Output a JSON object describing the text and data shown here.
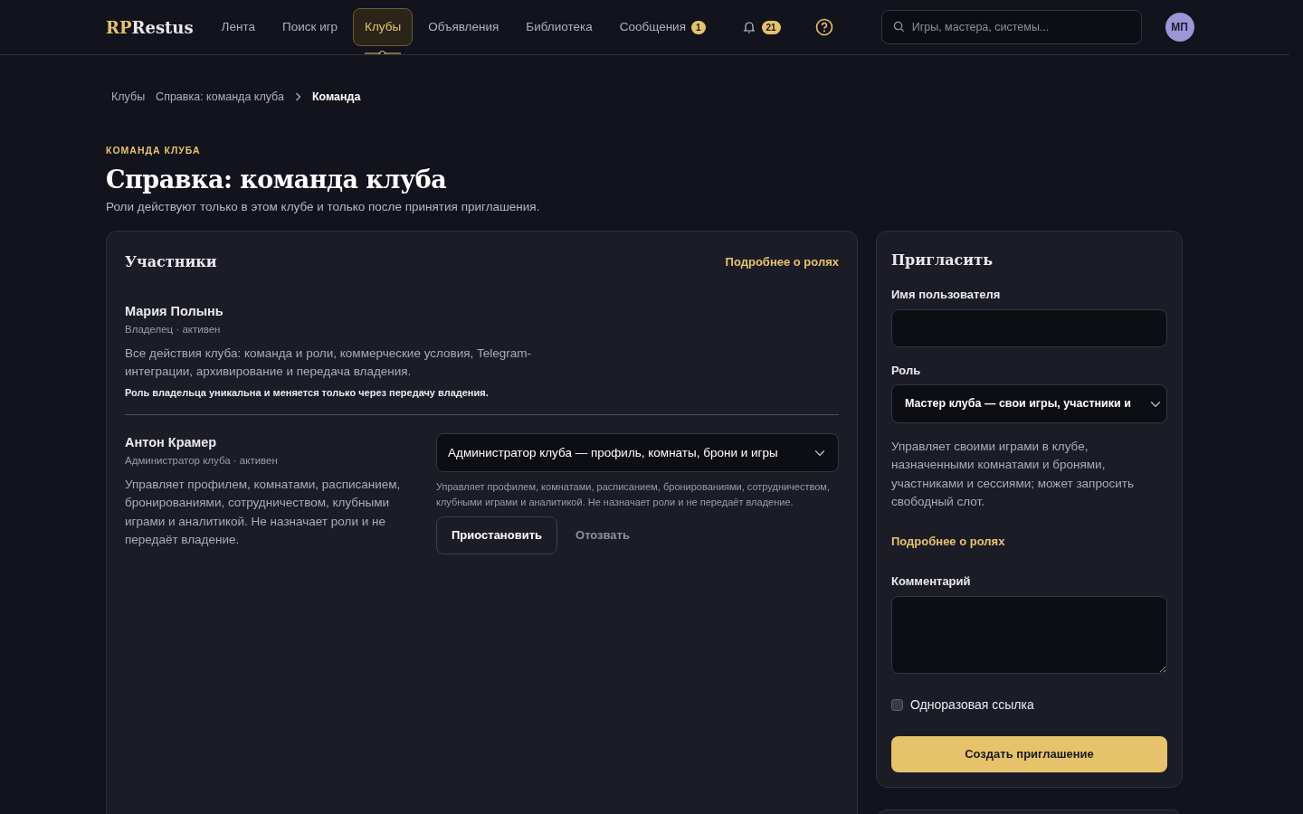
{
  "nav": {
    "logo": {
      "accent": "RP",
      "rest": "Restus"
    },
    "items": [
      {
        "label": "Лента",
        "selected": false
      },
      {
        "label": "Поиск игр",
        "selected": false
      },
      {
        "label": "Клубы",
        "selected": true
      },
      {
        "label": "Объявления",
        "selected": false
      },
      {
        "label": "Библиотека",
        "selected": false
      },
      {
        "label": "Сообщения",
        "selected": false,
        "badge": "1"
      }
    ],
    "notifications_badge": "21",
    "search": {
      "placeholder": "Игры, мастера, системы..."
    },
    "avatar": "МП"
  },
  "breadcrumbs": [
    {
      "label": "Клубы",
      "current": false
    },
    {
      "label": "Справка: команда клуба",
      "current": false
    },
    {
      "label": "Команда",
      "current": true
    }
  ],
  "eyebrow": "КОМАНДА КЛУБА",
  "title": "Справка: команда клуба",
  "subtitle": "Роли действуют только в этом клубе и только после принятия приглашения.",
  "members_card": {
    "title": "Участники",
    "link": "Подробнее о ролях",
    "members": [
      {
        "name": "Мария Полынь",
        "meta": "Владелец · активен",
        "description": "Все действия клуба: команда и роли, коммерческие условия, Telegram-интеграции, архивирование и передача владения.",
        "note": "Роль владельца уникальна и меняется только через передачу владения."
      },
      {
        "name": "Антон Крамер",
        "meta": "Администратор клуба · активен",
        "description": "Управляет профилем, комнатами, расписанием, бронированиями, сотрудничеством, клубными играми и аналитикой. Не назначает роли и не передаёт владение.",
        "role_select": "Администратор клуба — профиль, комнаты, брони и игры",
        "role_hint": "Управляет профилем, комнатами, расписанием, бронированиями, сотрудничеством, клубными играми и аналитикой. Не назначает роли и не передаёт владение.",
        "actions": [
          {
            "label": "Приостановить",
            "kind": "outline"
          },
          {
            "label": "Отозвать",
            "kind": "muted"
          }
        ]
      }
    ]
  },
  "invite": {
    "title": "Пригласить",
    "username_label": "Имя пользователя",
    "role_label": "Роль",
    "role_value": "Мастер клуба — свои игры, участники и",
    "role_hint": "Управляет своими играми в клубе, назначенными комнатами и бронями, участниками и сессиями; может запросить свободный слот.",
    "link": "Подробнее о ролях",
    "comment_label": "Комментарий",
    "one_time": {
      "label": "Одноразовая ссылка",
      "checked": false
    },
    "submit": "Создать приглашение"
  }
}
